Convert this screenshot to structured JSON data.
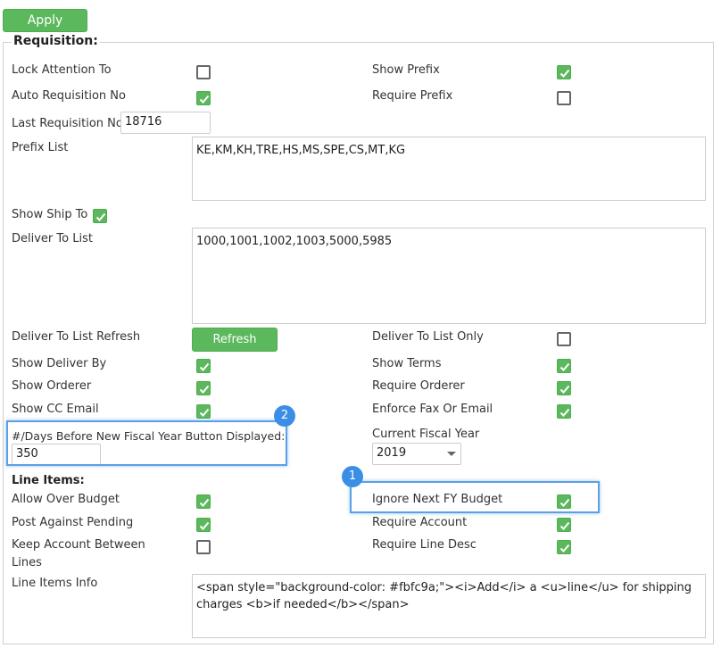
{
  "toolbar": {
    "apply_label": "Apply"
  },
  "requisition": {
    "legend": "Requisition:",
    "lock_attention_label": "Lock Attention To",
    "lock_attention_checked": false,
    "show_prefix_label": "Show Prefix",
    "show_prefix_checked": true,
    "auto_req_label": "Auto Requisition No",
    "auto_req_checked": true,
    "require_prefix_label": "Require Prefix",
    "require_prefix_checked": false,
    "last_req_label": "Last Requisition No",
    "last_req_value": "18716",
    "prefix_list_label": "Prefix List",
    "prefix_list_value": "KE,KM,KH,TRE,HS,MS,SPE,CS,MT,KG",
    "show_ship_to_label": "Show Ship To",
    "show_ship_to_checked": true,
    "deliver_to_list_label": "Deliver To List",
    "deliver_to_list_value": "1000,1001,1002,1003,5000,5985",
    "deliver_refresh_label": "Deliver To List Refresh",
    "refresh_button_label": "Refresh",
    "deliver_only_label": "Deliver To List Only",
    "deliver_only_checked": false,
    "show_deliver_by_label": "Show Deliver By",
    "show_deliver_by_checked": true,
    "show_terms_label": "Show Terms",
    "show_terms_checked": true,
    "show_orderer_label": "Show Orderer",
    "show_orderer_checked": true,
    "require_orderer_label": "Require Orderer",
    "require_orderer_checked": true,
    "show_cc_label": "Show CC Email",
    "show_cc_checked": true,
    "enforce_fax_label": "Enforce Fax Or Email",
    "enforce_fax_checked": true,
    "days_before_label": "#/Days Before New Fiscal Year Button Displayed:",
    "days_before_value": "350",
    "current_fy_label": "Current Fiscal Year",
    "current_fy_value": "2019"
  },
  "line_items": {
    "title": "Line Items:",
    "allow_over_label": "Allow Over Budget",
    "allow_over_checked": true,
    "ignore_next_label": "Ignore Next FY Budget",
    "ignore_next_checked": true,
    "post_against_label": "Post Against Pending",
    "post_against_checked": true,
    "require_account_label": "Require Account",
    "require_account_checked": true,
    "keep_account_label_1": "Keep Account Between",
    "keep_account_label_2": "Lines",
    "keep_account_checked": false,
    "require_line_desc_label": "Require Line Desc",
    "require_line_desc_checked": true,
    "info_label": "Line Items Info",
    "info_value": "<span style=\"background-color: #fbfc9a;\"><i>Add</i> a <u>line</u> for shipping charges <b>if needed</b></span>"
  },
  "annotations": {
    "badge_1": "1",
    "badge_2": "2"
  },
  "colors": {
    "accent_green": "#5cb85c",
    "highlight_blue": "#5aa0e6",
    "badge_blue": "#3b8ee6"
  }
}
